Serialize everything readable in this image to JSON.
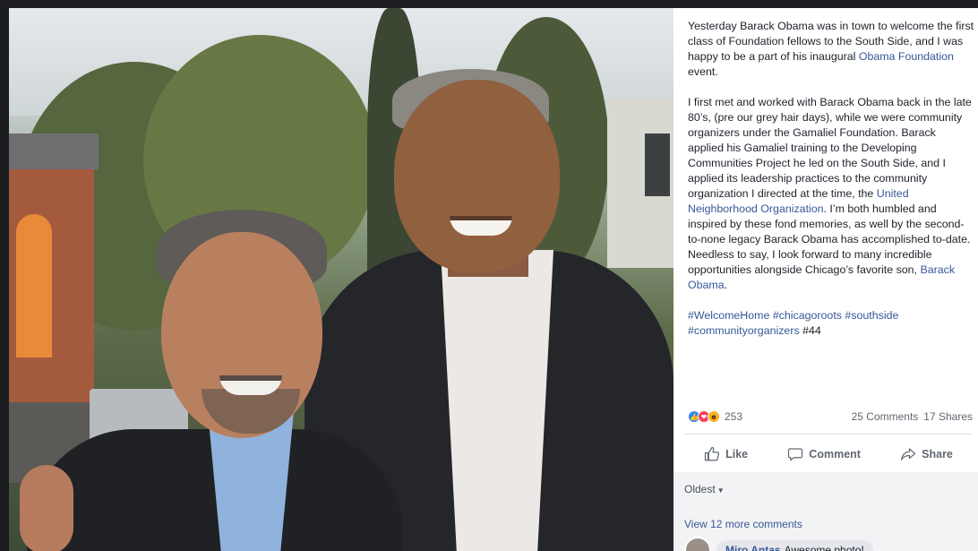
{
  "post": {
    "paragraph1": {
      "text_a": "Yesterday Barack Obama was in town to welcome the first class of Foundation fellows to the South Side, and I was happy to be a part of his inaugural ",
      "link": "Obama Foundation",
      "text_b": " event."
    },
    "paragraph2": {
      "text_a": "I first met and worked with Barack Obama back in the late 80’s, (pre our grey hair days), while we were community organizers under the Gamaliel Foundation. Barack applied his Gamaliel training to the Developing Communities Project he led on the South Side, and I applied its leadership practices to the community organization I directed at the time, the ",
      "link1": "United Neighborhood Organization",
      "text_b": ". I’m both humbled and inspired by these fond memories, as well by the second-to-none legacy Barack Obama has accomplished to-date. Needless to say, I look forward to many incredible opportunities alongside Chicago’s favorite son, ",
      "link2": "Barack Obama",
      "text_c": "."
    },
    "hashtags": [
      "#WelcomeHome",
      "#chicagoroots",
      "#southside",
      "#communityorganizers"
    ],
    "trailing_tag": "#44"
  },
  "stats": {
    "reaction_count": "253",
    "reaction_icons": [
      "like-icon",
      "love-icon",
      "haha-icon"
    ],
    "comments": "25 Comments",
    "shares": "17 Shares"
  },
  "actions": {
    "like": "Like",
    "comment": "Comment",
    "share": "Share"
  },
  "comments": {
    "sort_label": "Oldest",
    "view_more": "View 12 more comments",
    "first": {
      "author": "Miro Antas",
      "text": "Awesome photo!"
    }
  },
  "colors": {
    "link": "#365899",
    "like_blue": "#2d88ff",
    "love_red": "#f33e58",
    "haha_yellow": "#f7b125"
  }
}
